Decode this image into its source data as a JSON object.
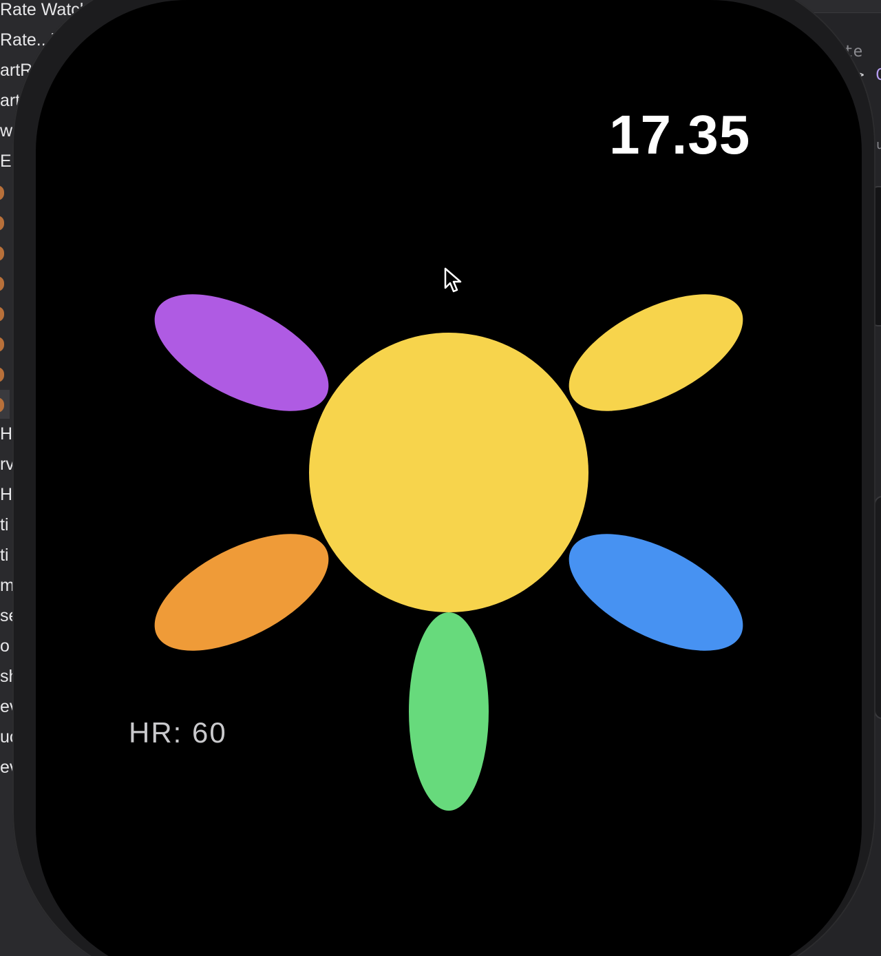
{
  "navigator": {
    "items": [
      {
        "label": "Rate WatchKit"
      },
      {
        "label": "Rate...hKit"
      },
      {
        "label": "artRate"
      },
      {
        "label": "artRa"
      },
      {
        "label": "ws"
      },
      {
        "label": "Ele"
      }
    ],
    "more_items": [
      {
        "label": "H"
      },
      {
        "label": "rv"
      },
      {
        "label": "H"
      },
      {
        "label": "ti"
      },
      {
        "label": "ti"
      },
      {
        "label": "m"
      },
      {
        "label": "se"
      },
      {
        "label": "o"
      },
      {
        "label": "sh"
      },
      {
        "label": "ev"
      },
      {
        "label": "uc"
      },
      {
        "label": "ev"
      }
    ]
  },
  "editor": {
    "lines": [
      {
        "text": "rate",
        "color": "#8a8a8f"
      },
      {
        "text": "->",
        "color": "#d0d0d4"
      },
      {
        "text": "C",
        "color": "#b59cf0"
      },
      {
        "text": "u",
        "color": "#8a8a8f"
      }
    ]
  },
  "watch": {
    "time": "17.35",
    "heart_rate": "HR: 60"
  },
  "flower": {
    "center_color": "#F7D44C",
    "petals": [
      {
        "name": "petal-top-left",
        "color": "#AF5BE3"
      },
      {
        "name": "petal-top-right",
        "color": "#F7D44C"
      },
      {
        "name": "petal-bottom-left",
        "color": "#EF9B38"
      },
      {
        "name": "petal-bottom-right",
        "color": "#4792F2"
      },
      {
        "name": "petal-bottom",
        "color": "#67DA7C"
      }
    ]
  }
}
